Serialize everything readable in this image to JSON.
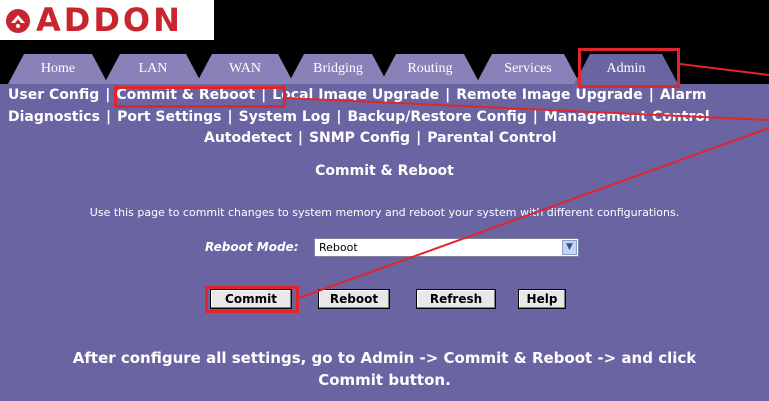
{
  "logo": {
    "text": "ADDON"
  },
  "tabs": [
    "Home",
    "LAN",
    "WAN",
    "Bridging",
    "Routing",
    "Services",
    "Admin"
  ],
  "active_tab": "Admin",
  "subnav": {
    "row1": [
      "User Config",
      "Commit & Reboot",
      "Local Image Upgrade",
      "Remote Image Upgrade",
      "Alarm"
    ],
    "row2": [
      "Diagnostics",
      "Port Settings",
      "System Log",
      "Backup/Restore Config",
      "Management Control"
    ],
    "row3": [
      "Autodetect",
      "SNMP Config",
      "Parental Control"
    ],
    "separator": "|"
  },
  "page": {
    "title": "Commit & Reboot",
    "description": "Use this page to commit changes to system memory and reboot your system with different configurations.",
    "reboot_mode_label": "Reboot Mode:",
    "reboot_mode_value": "Reboot"
  },
  "buttons": {
    "commit": "Commit",
    "reboot": "Reboot",
    "refresh": "Refresh",
    "help": "Help"
  },
  "footer": {
    "line1": "After configure all settings, go to Admin -> Commit & Reboot -> and click",
    "line2": "Commit button."
  },
  "colors": {
    "panel": "#6b64a2",
    "tab": "#8882b8",
    "active_tab": "#6b64a2",
    "highlight": "#e0262c",
    "logo": "#c8252f"
  }
}
